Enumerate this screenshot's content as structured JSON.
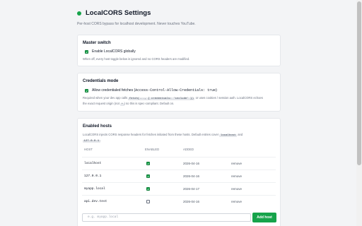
{
  "header": {
    "title": "LocalCORS Settings",
    "subtitle": "Per-host CORS bypass for localhost development. Never touches YouTube."
  },
  "colors": {
    "accent": "#16a34a",
    "background": "#f3f4f6",
    "card": "#ffffff"
  },
  "master": {
    "title": "Master switch",
    "checkbox_label": "Enable LocalCORS globally",
    "checked": true,
    "hint": "When off, every host toggle below is ignored and no CORS headers are modified."
  },
  "credentials": {
    "title": "Credentials mode",
    "checkbox_label_prefix": "Allow credentialed fetches (",
    "checkbox_label_code": "Access-Control-Allow-Credentials: true",
    "checkbox_label_suffix": ")",
    "checked": true,
    "hint_1": "Required when your dev app calls",
    "hint_chip_1": "fetch(..., { credentials: 'include' })",
    "hint_2": "or uses cookies / session auth. LocalCORS echoes",
    "hint_3": "the exact request origin (not",
    "hint_chip_2": "*",
    "hint_4": ") so this is spec-compliant. Default on."
  },
  "hosts": {
    "title": "Enabled hosts",
    "desc_1": "LocalCORS injects CORS response headers for fetches initiated from these hosts. Default entries cover",
    "desc_chip_1": "localhost",
    "desc_2": "and",
    "desc_chip_2": "127.0.0.1",
    "desc_3": ".",
    "columns": {
      "host": "HOST",
      "enabled": "ENABLED",
      "added": "ADDED"
    },
    "rows": [
      {
        "host": "localhost",
        "enabled": true,
        "added": "2026-04-16",
        "action": "remove"
      },
      {
        "host": "127.0.0.1",
        "enabled": true,
        "added": "2026-04-16",
        "action": "remove"
      },
      {
        "host": "myapp.local",
        "enabled": true,
        "added": "2026-04-17",
        "action": "remove"
      },
      {
        "host": "api.dev.test",
        "enabled": false,
        "added": "2026-04-16",
        "action": "remove"
      }
    ],
    "input_placeholder": "e.g. myapp.local",
    "add_button_label": "Add host"
  }
}
